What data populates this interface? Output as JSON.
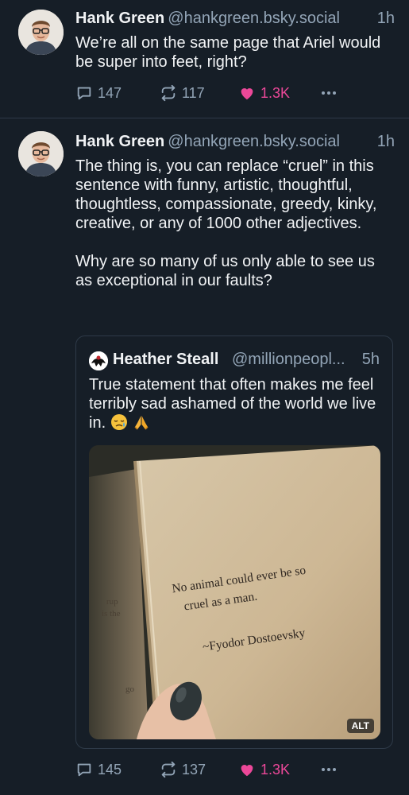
{
  "posts": [
    {
      "author_name": "Hank Green",
      "handle": "@hankgreen.bsky.social",
      "time": "1h",
      "text": "We’re all on the same page that Ariel would be super into feet, right?",
      "reply_count": "147",
      "repost_count": "117",
      "like_count": "1.3K",
      "liked": true
    },
    {
      "author_name": "Hank Green",
      "handle": "@hankgreen.bsky.social",
      "time": "1h",
      "text": "The thing is, you can replace “cruel” in this sentence with funny, artistic, thoughtful, thoughtless, compassionate, greedy, kinky, creative, or any of 1000 other adjectives.\n\nWhy are so many of us only able to see us as exceptional in our faults?",
      "reply_count": "145",
      "repost_count": "137",
      "like_count": "1.3K",
      "liked": true,
      "quote": {
        "author_name": "Heather Steall",
        "handle": "@millionpeopl...",
        "time": "5h",
        "text": "True statement that often makes me feel terribly sad ashamed of the world we live in.",
        "emojis": [
          "crying-face",
          "folded-hands"
        ],
        "image": {
          "alt_badge": "ALT",
          "quote_line1": "No animal could ever be so",
          "quote_line2": "cruel as a man.",
          "attribution": "~Fyodor Dostoevsky",
          "left_page_text": [
            "rup",
            "is the",
            "go"
          ]
        }
      }
    }
  ],
  "icons": {
    "reply": "speech-bubble-icon",
    "repost": "repost-arrows-icon",
    "like": "heart-icon",
    "more": "ellipsis-icon"
  },
  "colors": {
    "background": "#161e27",
    "text_primary": "#f1f3f5",
    "text_secondary": "#93a5b7",
    "like_active": "#ec4899",
    "border": "#2e3a48"
  }
}
